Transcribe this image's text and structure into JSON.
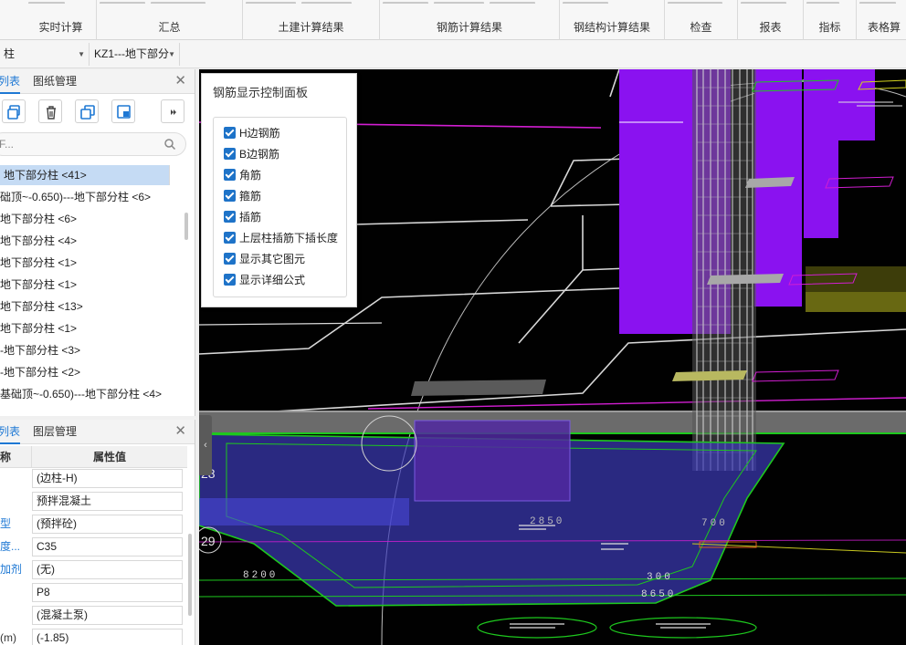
{
  "ribbon": {
    "groups": [
      {
        "label": "实时计算"
      },
      {
        "label": "汇总"
      },
      {
        "label": "土建计算结果"
      },
      {
        "label": "钢筋计算结果"
      },
      {
        "label": "钢结构计算结果"
      },
      {
        "label": "检查"
      },
      {
        "label": "报表"
      },
      {
        "label": "指标"
      },
      {
        "label": "表格算"
      }
    ]
  },
  "selectors": {
    "category": "柱",
    "element": "KZ1---地下部分"
  },
  "top_panel": {
    "tabs": [
      "列表",
      "图纸管理"
    ],
    "search_placeholder": "F...",
    "items": [
      "地下部分柱 <41>",
      "础顶~-0.650)---地下部分柱 <6>",
      "地下部分柱 <6>",
      "地下部分柱 <4>",
      "地下部分柱 <1>",
      "地下部分柱 <1>",
      "地下部分柱 <13>",
      "地下部分柱 <1>",
      "-地下部分柱 <3>",
      "-地下部分柱 <2>",
      "基础顶~-0.650)---地下部分柱 <4>"
    ],
    "selected_index": 0
  },
  "bottom_panel": {
    "tabs": [
      "列表",
      "图层管理"
    ],
    "col_name": "称",
    "col_value": "属性值",
    "rows": [
      {
        "name": "",
        "value": "(边柱-H)",
        "blue": false
      },
      {
        "name": "",
        "value": "预拌混凝土",
        "blue": false
      },
      {
        "name": "型",
        "value": "(预拌砼)",
        "blue": true
      },
      {
        "name": "度...",
        "value": "C35",
        "blue": true
      },
      {
        "name": "加剂",
        "value": "(无)",
        "blue": true
      },
      {
        "name": "",
        "value": "P8",
        "blue": false
      },
      {
        "name": "",
        "value": "(混凝土泵)",
        "blue": false
      },
      {
        "name": "(m)",
        "value": "(-1.85)",
        "blue": false
      }
    ]
  },
  "control_panel": {
    "title": "钢筋显示控制面板",
    "options": [
      {
        "label": "H边钢筋",
        "checked": true
      },
      {
        "label": "B边钢筋",
        "checked": true
      },
      {
        "label": "角筋",
        "checked": true
      },
      {
        "label": "箍筋",
        "checked": true
      },
      {
        "label": "插筋",
        "checked": true
      },
      {
        "label": "上层柱插筋下插长度",
        "checked": true
      },
      {
        "label": "显示其它图元",
        "checked": true
      },
      {
        "label": "显示详细公式",
        "checked": true
      }
    ]
  },
  "viewport": {
    "axis_labels": [
      "28",
      "29"
    ],
    "dimensions": [
      "2850",
      "700",
      "8200",
      "300",
      "8650"
    ],
    "colors": {
      "background": "#010101",
      "column": "#8a12f0",
      "foundation_edge": "#1ec81e",
      "rebar": "#c8c8c8",
      "link": "#d21ed2"
    }
  },
  "colors": {
    "accent": "#1e78d4",
    "selected_row": "#c5dbf4",
    "checkbox": "#1e73c8"
  }
}
